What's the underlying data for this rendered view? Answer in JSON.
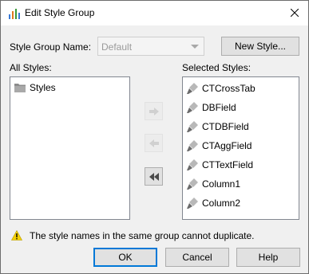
{
  "window": {
    "title": "Edit Style Group",
    "close_glyph": "✕"
  },
  "form": {
    "group_name_label": "Style Group Name:",
    "group_name_value": "Default",
    "new_style_button": "New Style..."
  },
  "all_styles": {
    "label": "All Styles:",
    "items": [
      {
        "label": "Styles",
        "icon": "folder-icon"
      }
    ]
  },
  "selected_styles": {
    "label": "Selected Styles:",
    "items": [
      {
        "label": "CTCrossTab",
        "icon": "style-brush-icon"
      },
      {
        "label": "DBField",
        "icon": "style-brush-icon"
      },
      {
        "label": "CTDBField",
        "icon": "style-brush-icon"
      },
      {
        "label": "CTAggField",
        "icon": "style-brush-icon"
      },
      {
        "label": "CTTextField",
        "icon": "style-brush-icon"
      },
      {
        "label": "Column1",
        "icon": "style-brush-icon"
      },
      {
        "label": "Column2",
        "icon": "style-brush-icon"
      }
    ]
  },
  "transfer_buttons": {
    "add": {
      "icon": "arrow-right-icon",
      "enabled": false
    },
    "remove": {
      "icon": "arrow-left-icon",
      "enabled": false
    },
    "remove_all": {
      "icon": "double-arrow-left-icon",
      "enabled": true
    }
  },
  "message": {
    "icon": "warning-icon",
    "text": "The style names in the same group cannot duplicate."
  },
  "footer": {
    "ok": "OK",
    "cancel": "Cancel",
    "help": "Help"
  },
  "colors": {
    "accent": "#0078d7",
    "warning": "#f5d000"
  }
}
